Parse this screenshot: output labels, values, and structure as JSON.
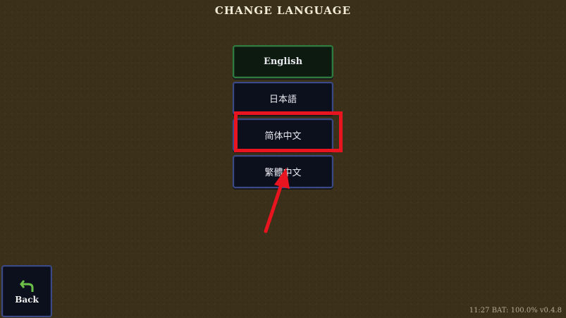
{
  "screen": {
    "title": "CHANGE LANGUAGE"
  },
  "languages": [
    {
      "label": "English",
      "selected": true
    },
    {
      "label": "日本語",
      "selected": false
    },
    {
      "label": "简体中文",
      "selected": false
    },
    {
      "label": "繁體中文",
      "selected": false
    }
  ],
  "back_button": {
    "label": "Back",
    "icon": "back-arrow-icon"
  },
  "status_bar": {
    "text": "11:27 BAT: 100.0% v0.4.8"
  },
  "annotation": {
    "highlight_color": "#e8141f",
    "highlighted_item": "简体中文"
  },
  "colors": {
    "background": "#3b3019",
    "button_bg": "#0c0f1c",
    "button_border": "#3b4a86",
    "selected_border": "#2f7a3e",
    "back_icon": "#6cc04a"
  }
}
